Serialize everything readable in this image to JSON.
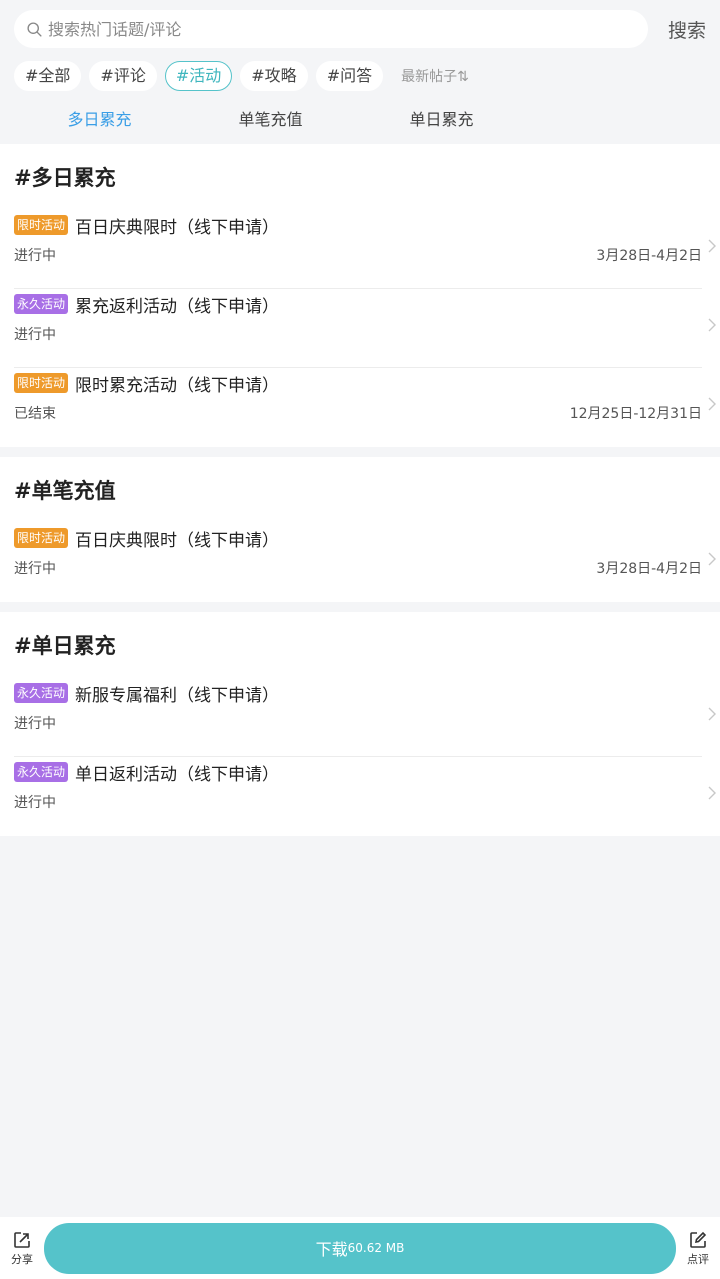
{
  "search": {
    "placeholder": "搜索热门话题/评论",
    "button": "搜索"
  },
  "chips": [
    "#全部",
    "#评论",
    "#活动",
    "#攻略",
    "#问答"
  ],
  "active_chip": "#活动",
  "sort_label": "最新帖子⇅",
  "tabs": [
    "多日累充",
    "单笔充值",
    "单日累充"
  ],
  "active_tab": "多日累充",
  "sections": [
    {
      "title": "#多日累充",
      "items": [
        {
          "badge": "限时活动",
          "badge_color": "#ee9a2b",
          "title": "百日庆典限时（线下申请）",
          "status": "进行中",
          "date": "3月28日-4月2日"
        },
        {
          "badge": "永久活动",
          "badge_color": "#a86fe6",
          "title": "累充返利活动（线下申请）",
          "status": "进行中",
          "date": ""
        },
        {
          "badge": "限时活动",
          "badge_color": "#ee9a2b",
          "title": "限时累充活动（线下申请）",
          "status": "已结束",
          "date": "12月25日-12月31日"
        }
      ]
    },
    {
      "title": "#单笔充值",
      "items": [
        {
          "badge": "限时活动",
          "badge_color": "#ee9a2b",
          "title": "百日庆典限时（线下申请）",
          "status": "进行中",
          "date": "3月28日-4月2日"
        }
      ]
    },
    {
      "title": "#单日累充",
      "items": [
        {
          "badge": "永久活动",
          "badge_color": "#a86fe6",
          "title": "新服专属福利（线下申请）",
          "status": "进行中",
          "date": ""
        },
        {
          "badge": "永久活动",
          "badge_color": "#a86fe6",
          "title": "单日返利活动（线下申请）",
          "status": "进行中",
          "date": ""
        }
      ]
    }
  ],
  "bottom": {
    "share_label": "分享",
    "download_label": "下载",
    "download_size": "60.62 MB",
    "review_label": "点评",
    "download_color": "#55c3ca"
  }
}
